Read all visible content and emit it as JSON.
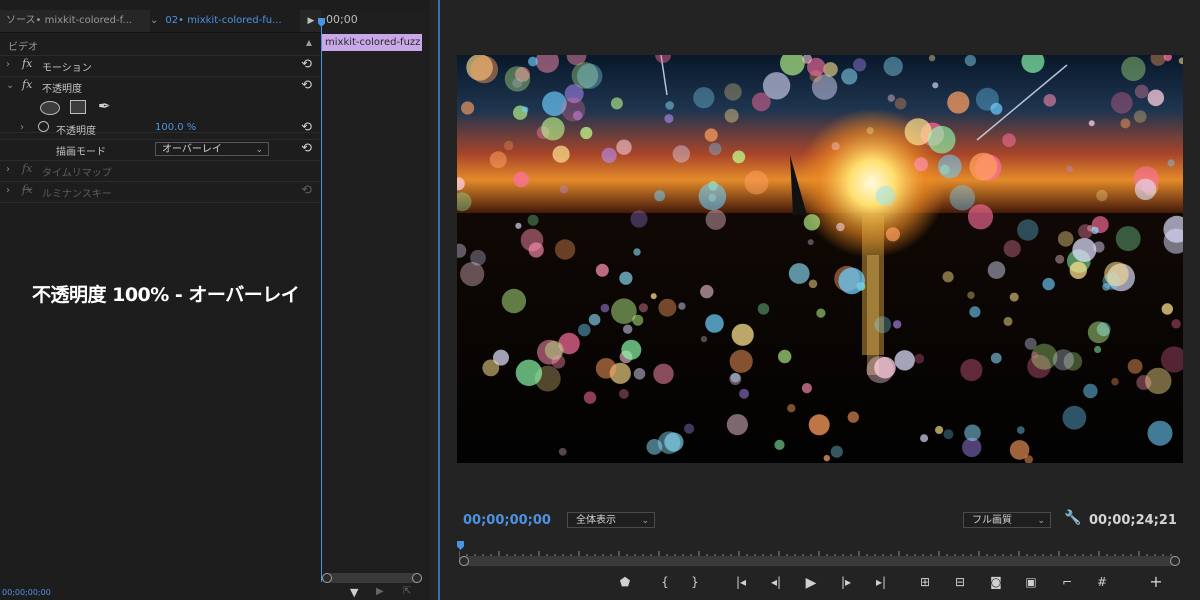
{
  "effect_controls": {
    "tabs": {
      "source": "ソース• mixkit-colored-f...",
      "sequence": "02• mixkit-colored-fu...",
      "arrow": "▶"
    },
    "section_header": "ビデオ",
    "rows": {
      "motion": "モーション",
      "opacity": "不透明度",
      "opacity_param": "不透明度",
      "opacity_value": "100.0 %",
      "blend_mode_label": "描画モード",
      "blend_mode_value": "オーバーレイ",
      "time_remap": "タイムリマップ",
      "luminance_key": "ルミナンスキー"
    },
    "fx_symbol": "fx",
    "caption": "不透明度 100% - オーバーレイ",
    "timeline": {
      "time": "00;00",
      "clip_name": "mixkit-colored-fuzz"
    },
    "footer_time": "00;00;00;00"
  },
  "program_monitor": {
    "current_time": "00;00;00;00",
    "zoom": "全体表示",
    "quality": "フル画質",
    "duration": "00;00;24;21",
    "controls": [
      {
        "name": "add-marker-icon",
        "glyph": "⬟"
      },
      {
        "name": "mark-in-icon",
        "glyph": "{"
      },
      {
        "name": "mark-out-icon",
        "glyph": "}"
      },
      {
        "name": "go-to-in-icon",
        "glyph": "|◂"
      },
      {
        "name": "step-back-icon",
        "glyph": "◂|"
      },
      {
        "name": "play-icon",
        "glyph": "▶"
      },
      {
        "name": "step-forward-icon",
        "glyph": "|▸"
      },
      {
        "name": "go-to-out-icon",
        "glyph": "▸|"
      },
      {
        "name": "lift-icon",
        "glyph": "⊞"
      },
      {
        "name": "extract-icon",
        "glyph": "⊟"
      },
      {
        "name": "export-frame-icon",
        "glyph": "◙"
      },
      {
        "name": "compare-icon",
        "glyph": "▣"
      },
      {
        "name": "safe-margins-icon",
        "glyph": "⌐"
      },
      {
        "name": "grid-icon",
        "glyph": "#"
      },
      {
        "name": "add-button-icon",
        "glyph": "+"
      }
    ]
  },
  "colors": {
    "accent_blue": "#4c93e4",
    "clip_purple": "#c8a8e8",
    "panel_bg": "#1d1d1d"
  }
}
